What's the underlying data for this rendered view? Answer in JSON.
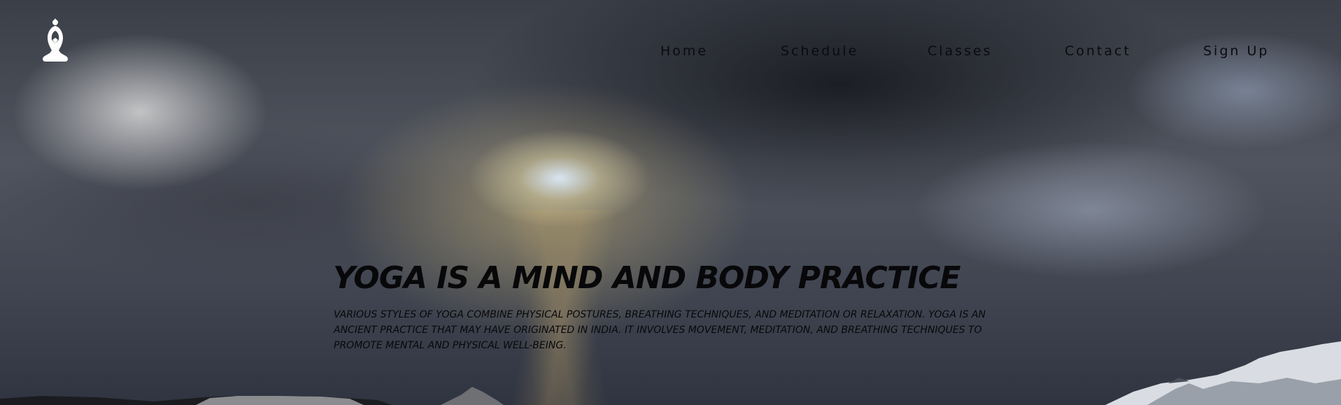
{
  "header": {
    "logo_icon": "yoga-meditation-icon"
  },
  "nav": {
    "items": [
      {
        "label": "Home"
      },
      {
        "label": "Schedule"
      },
      {
        "label": "Classes"
      },
      {
        "label": "Contact"
      },
      {
        "label": "Sign Up"
      }
    ]
  },
  "hero": {
    "headline": "YOGA IS A MIND AND BODY PRACTICE",
    "description": "VARIOUS STYLES OF YOGA COMBINE PHYSICAL POSTURES, BREATHING TECHNIQUES, AND MEDITATION OR RELAXATION. YOGA IS AN ANCIENT PRACTICE THAT MAY HAVE ORIGINATED IN INDIA. IT INVOLVES MOVEMENT, MEDITATION, AND BREATHING TECHNIQUES TO PROMOTE MENTAL AND PHYSICAL WELL-BEING."
  },
  "colors": {
    "text": "#08080a",
    "logo": "#ffffff"
  }
}
